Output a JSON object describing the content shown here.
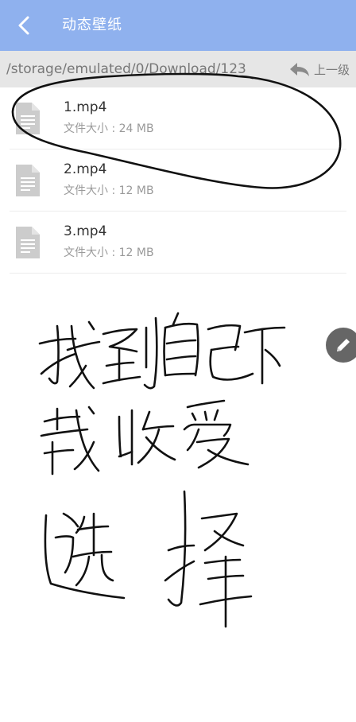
{
  "header": {
    "title": "动态壁纸"
  },
  "pathbar": {
    "path": "/storage/emulated/0/Download/123",
    "up_label": "上一级"
  },
  "files": [
    {
      "name": "1.mp4",
      "size": "文件大小 : 24 MB"
    },
    {
      "name": "2.mp4",
      "size": "文件大小 : 12 MB"
    },
    {
      "name": "3.mp4",
      "size": "文件大小 : 12 MB"
    }
  ],
  "colors": {
    "header_bg": "#8fb1ee",
    "pathbar_bg": "#e6e6e6",
    "icon_gray": "#cccccc",
    "ink": "#111111"
  },
  "icons": {
    "back": "chevron-left-icon",
    "up": "reply-arrow-icon",
    "file": "document-icon",
    "edit": "pencil-icon"
  }
}
